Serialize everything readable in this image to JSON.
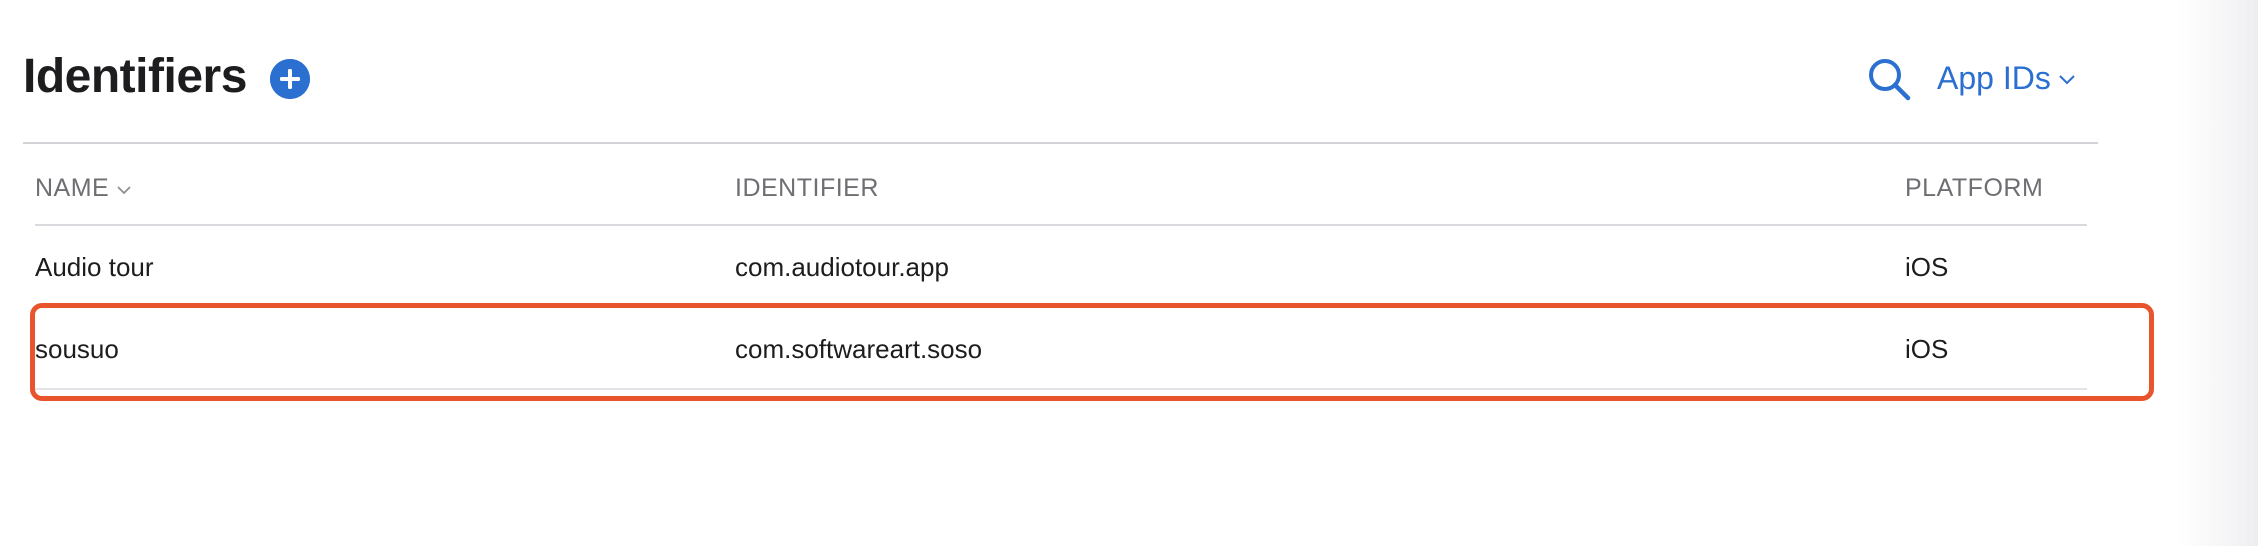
{
  "header": {
    "title": "Identifiers",
    "add_icon": "plus-circle-icon",
    "search_icon": "search-icon",
    "filter": {
      "selected": "App IDs",
      "icon": "chevron-down-icon"
    }
  },
  "table": {
    "columns": [
      {
        "label": "NAME",
        "sortable": true,
        "sort_icon": "chevron-down-icon"
      },
      {
        "label": "IDENTIFIER"
      },
      {
        "label": "PLATFORM"
      }
    ],
    "rows": [
      {
        "name": "Audio tour",
        "identifier": "com.audiotour.app",
        "platform": "iOS"
      },
      {
        "name": "sousuo",
        "identifier": "com.softwareart.soso",
        "platform": "iOS",
        "highlighted": true
      }
    ]
  },
  "colors": {
    "accent": "#2b6fd1",
    "title": "#1d1d1f",
    "muted": "#6e6e73",
    "divider": "#d2d2d7",
    "highlight": "#e8542c"
  }
}
